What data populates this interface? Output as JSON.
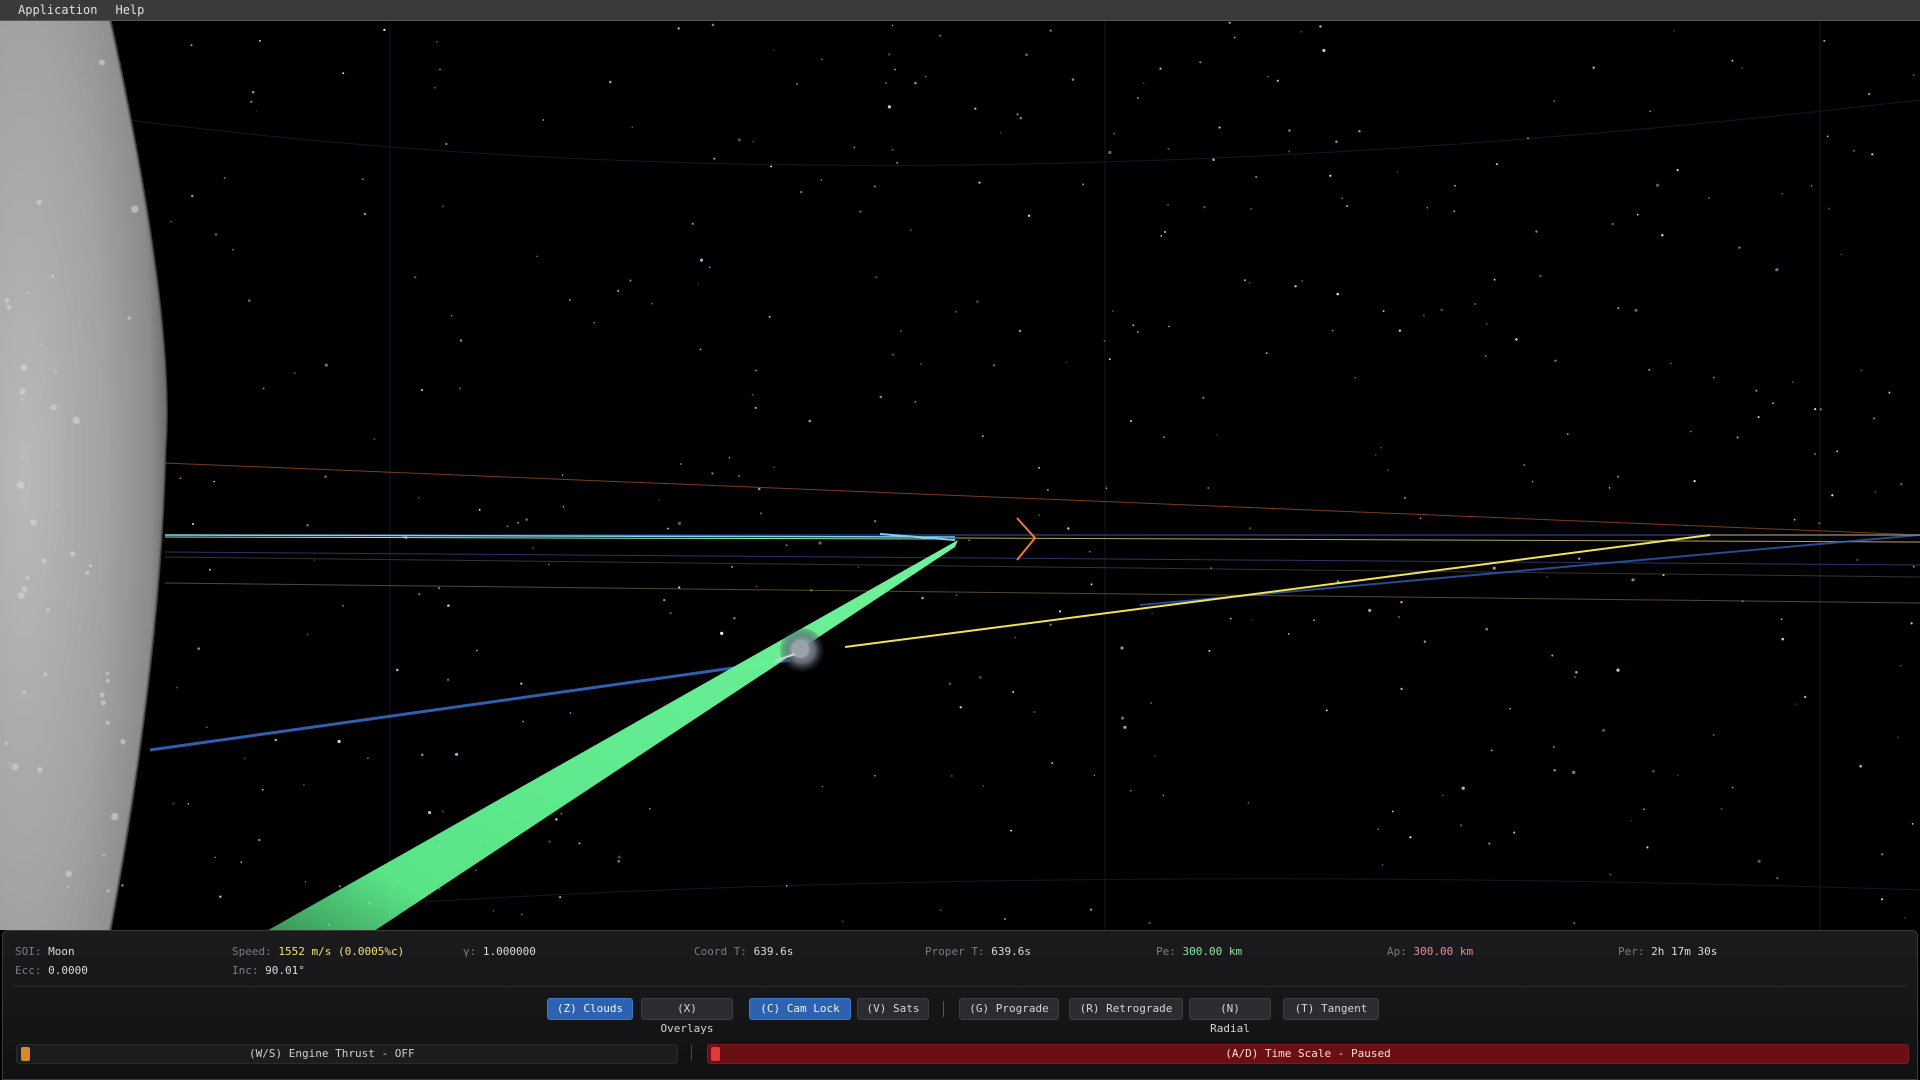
{
  "menu": [
    "Application",
    "Help"
  ],
  "stats": {
    "soi": {
      "key": "SOI:",
      "value": "Moon"
    },
    "ecc": {
      "key": "Ecc:",
      "value": "0.0000"
    },
    "speed": {
      "key": "Speed:",
      "value": "1552 m/s (0.0005%c)"
    },
    "inc": {
      "key": "Inc:",
      "value": "90.01°"
    },
    "gamma": {
      "key": "γ:",
      "value": "1.000000"
    },
    "coord_t": {
      "key": "Coord T:",
      "value": "639.6s"
    },
    "proper_t": {
      "key": "Proper T:",
      "value": "639.6s"
    },
    "pe": {
      "key": "Pe:",
      "value": "300.00 km"
    },
    "ap": {
      "key": "Ap:",
      "value": "300.00 km"
    },
    "per": {
      "key": "Per:",
      "value": "2h 17m 30s"
    }
  },
  "buttons": {
    "clouds": "(Z) Clouds",
    "overlays": "(X) Overlays",
    "camlock": "(C) Cam Lock",
    "sats": "(V) Sats",
    "prograde": "(G) Prograde",
    "retrograde": "(R) Retrograde",
    "radial": "(N) Radial",
    "tangent": "(T) Tangent"
  },
  "active_buttons": [
    "clouds",
    "camlock"
  ],
  "thrust": {
    "label": "(W/S)  Engine Thrust  -  OFF",
    "level": 0
  },
  "timescale": {
    "label": "(A/D)  Time Scale  -  Paused"
  },
  "colors": {
    "thrust_plume": "#5ef08e",
    "orbit_yellow": "#f2e25a",
    "orbit_blue": "#2f5fb0",
    "prograde_marker": "#f07a3a",
    "active_button": "#2c62b0",
    "timescale_bar": "#6b0f12"
  }
}
